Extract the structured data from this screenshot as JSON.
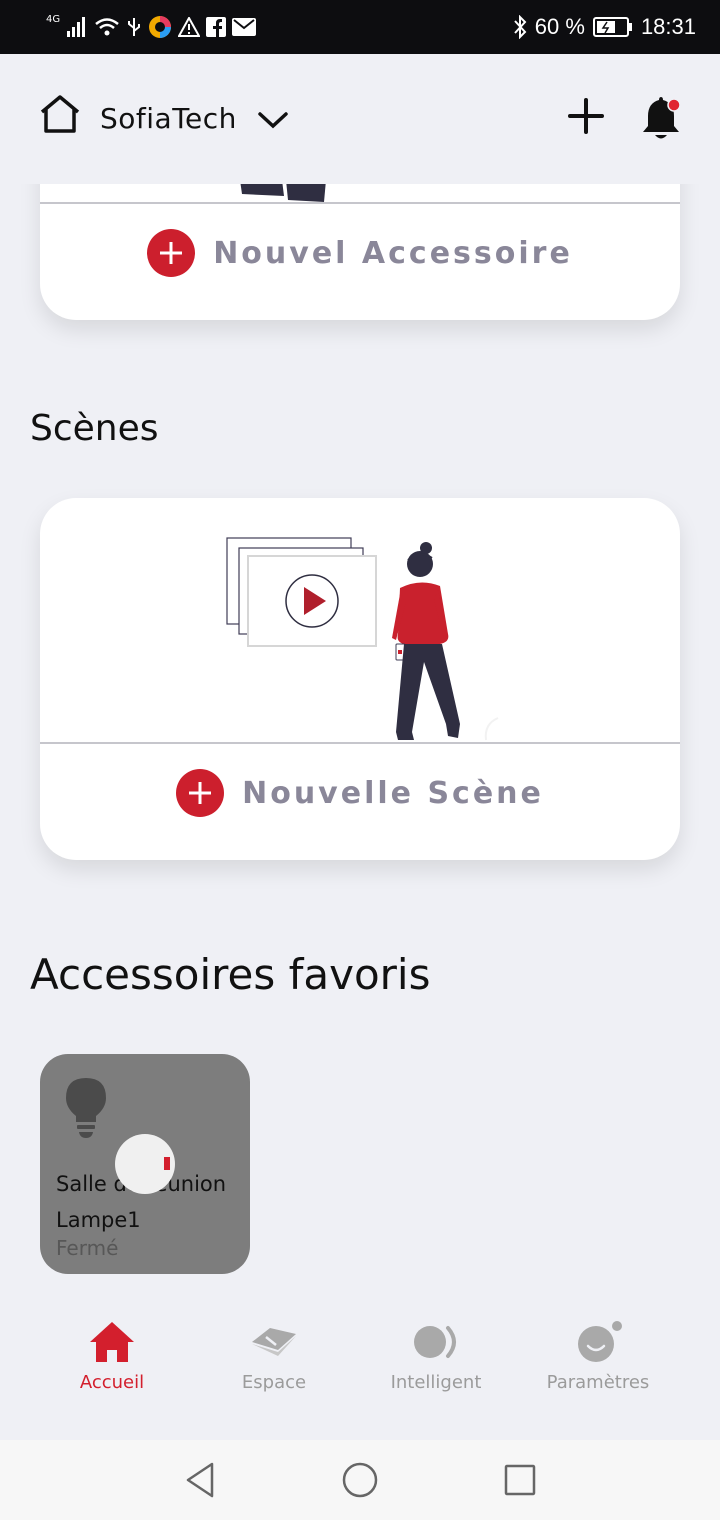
{
  "status_bar": {
    "network": "4G",
    "battery": "60 %",
    "time": "18:31"
  },
  "header": {
    "home_name": "SofiaTech"
  },
  "accessories_card": {
    "add_label": "Nouvel Accessoire"
  },
  "scenes": {
    "title": "Scènes",
    "add_label": "Nouvelle Scène"
  },
  "favorites": {
    "title": "Accessoires favoris",
    "items": [
      {
        "name_line1": "Salle de réunion",
        "name_line2": "Lampe1",
        "status": "Fermé"
      }
    ]
  },
  "tabbar": {
    "tabs": [
      {
        "label": "Accueil",
        "icon": "home-icon",
        "active": true
      },
      {
        "label": "Espace",
        "icon": "space-icon",
        "active": false
      },
      {
        "label": "Intelligent",
        "icon": "smart-icon",
        "active": false
      },
      {
        "label": "Paramètres",
        "icon": "settings-icon",
        "active": false
      }
    ]
  },
  "colors": {
    "accent": "#cc1f2d",
    "background": "#eff0f5",
    "tile": "#7d7d7d"
  }
}
